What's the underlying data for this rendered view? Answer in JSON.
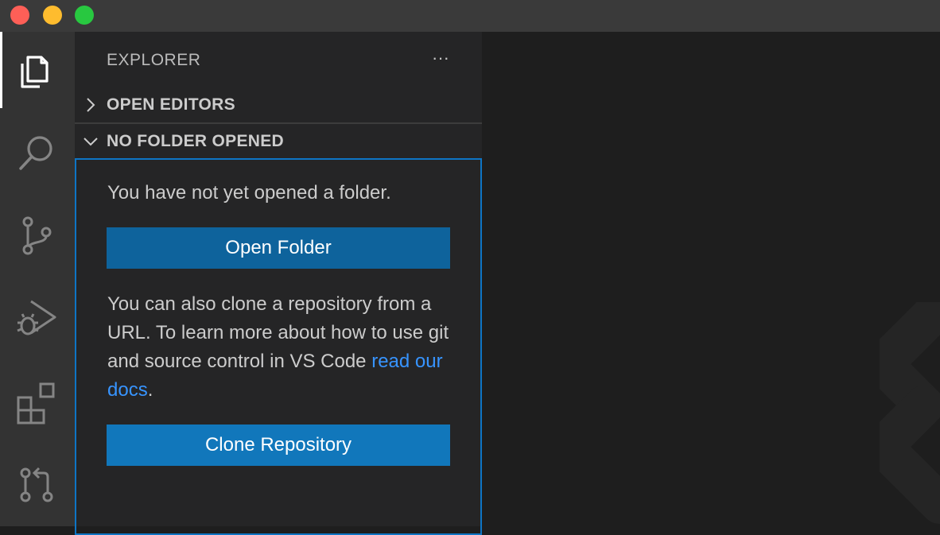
{
  "window": {
    "controls": [
      "close",
      "minimize",
      "maximize"
    ]
  },
  "activity_bar": {
    "items": [
      {
        "icon": "files-icon",
        "active": true
      },
      {
        "icon": "search-icon"
      },
      {
        "icon": "source-control-icon"
      },
      {
        "icon": "run-debug-icon"
      },
      {
        "icon": "extensions-icon"
      },
      {
        "icon": "pull-request-icon"
      }
    ]
  },
  "sidebar": {
    "title": "EXPLORER",
    "more": "···",
    "sections": {
      "open_editors": "OPEN EDITORS",
      "no_folder": "NO FOLDER OPENED"
    },
    "welcome": {
      "message1": "You have not yet opened a folder.",
      "open_folder_button": "Open Folder",
      "message2_prefix": "You can also clone a repository from a URL. To learn more about how to use git and source control in VS Code ",
      "message2_link": "read our docs",
      "message2_suffix": ".",
      "clone_button": "Clone Repository"
    }
  },
  "colors": {
    "accent": "#0e75c5",
    "button_primary": "#0e639c",
    "button_secondary": "#1177bb",
    "link": "#3794ff"
  }
}
